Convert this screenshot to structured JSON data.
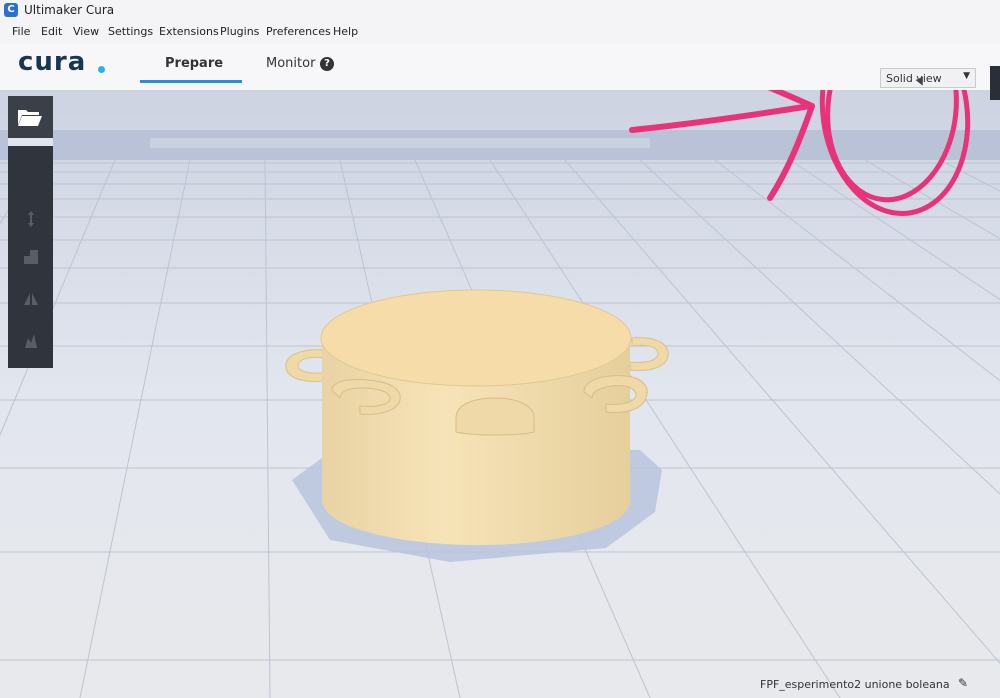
{
  "window": {
    "title": "Ultimaker Cura",
    "app_icon_letter": "C"
  },
  "menu": {
    "items": [
      "File",
      "Edit",
      "View",
      "Settings",
      "Extensions",
      "Plugins",
      "Preferences",
      "Help"
    ]
  },
  "header": {
    "brand": "cura",
    "tabs": [
      {
        "label": "Prepare",
        "active": true
      },
      {
        "label": "Monitor",
        "active": false
      }
    ],
    "monitor_badge": "?"
  },
  "view_select": {
    "selected": "Solid view"
  },
  "toolbar": {
    "icons": [
      "folder-open-icon",
      "move-icon",
      "scale-icon",
      "mirror-icon",
      "support-icon"
    ]
  },
  "footer": {
    "job_name": "FPF_esperimento2 unione boleana",
    "edit_icon": "pencil-icon"
  },
  "colors": {
    "model": "#f2d9a6",
    "toolbar": "#30343c",
    "accent": "#2a8fd8",
    "annotation": "#e8337a"
  }
}
